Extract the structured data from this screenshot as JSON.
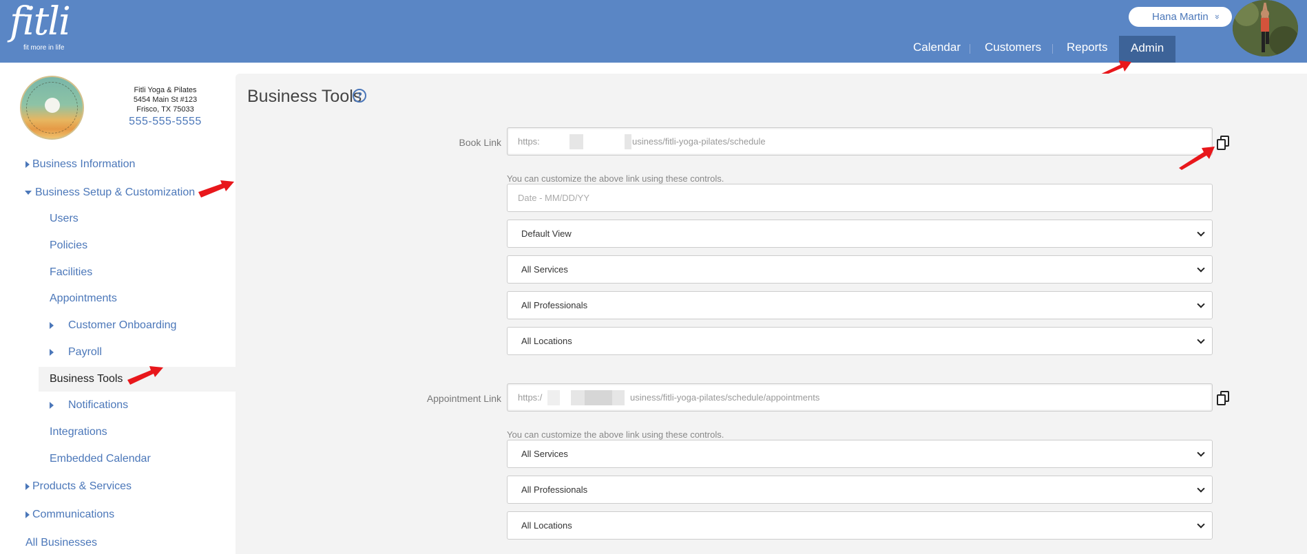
{
  "header": {
    "logo_text": "fitli",
    "logo_tagline": "fit more in life",
    "user_name": "Hana Martin",
    "user_chevron": "»",
    "nav": [
      {
        "label": "Calendar"
      },
      {
        "label": "Customers"
      },
      {
        "label": "Reports"
      },
      {
        "label": "Admin",
        "active": true
      }
    ]
  },
  "business": {
    "name": "Fitli Yoga & Pilates",
    "address1": "5454 Main St #123",
    "address2": "Frisco, TX 75033",
    "phone": "555-555-5555"
  },
  "sidebar": {
    "business_information": "Business Information",
    "setup_customization": "Business Setup & Customization",
    "users": "Users",
    "policies": "Policies",
    "facilities": "Facilities",
    "appointments": "Appointments",
    "customer_onboarding": "Customer Onboarding",
    "payroll": "Payroll",
    "business_tools": "Business Tools",
    "notifications": "Notifications",
    "integrations": "Integrations",
    "embedded_calendar": "Embedded Calendar",
    "products_services": "Products & Services",
    "communications": "Communications",
    "all_businesses": "All Businesses"
  },
  "main": {
    "title": "Business Tools",
    "help_glyph": "?",
    "book_link": {
      "label": "Book Link",
      "prefix": "https:",
      "suffix": "usiness/fitli-yoga-pilates/schedule",
      "hint": "You can customize the above link using these controls.",
      "date_placeholder": "Date - MM/DD/YY",
      "selects": [
        "Default View",
        "All Services",
        "All Professionals",
        "All Locations"
      ]
    },
    "appointment_link": {
      "label": "Appointment Link",
      "prefix": "https:/",
      "suffix": "usiness/fitli-yoga-pilates/schedule/appointments",
      "hint": "You can customize the above link using these controls.",
      "selects": [
        "All Services",
        "All Professionals",
        "All Locations"
      ]
    }
  },
  "colors": {
    "header_bg": "#5a86c5",
    "admin_tab_bg": "#3d6398",
    "link_blue": "#4b77b9",
    "annotation_arrow": "#e8171b"
  }
}
